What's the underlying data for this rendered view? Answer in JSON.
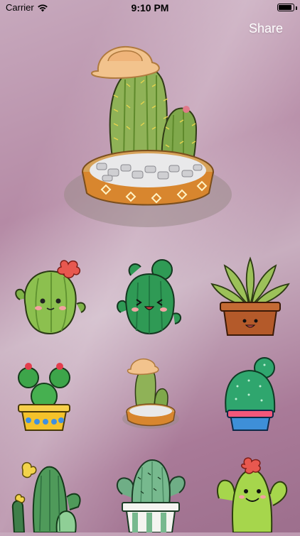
{
  "status_bar": {
    "carrier": "Carrier",
    "time": "9:10 PM",
    "battery_level": 0.9
  },
  "nav": {
    "share_label": "Share"
  },
  "hero": {
    "icon": "potted-cactus-with-hat-icon"
  },
  "stickers": [
    {
      "icon": "cute-round-cactus-with-flower-icon"
    },
    {
      "icon": "smiling-green-cactus-icon"
    },
    {
      "icon": "succulent-in-brown-pot-icon"
    },
    {
      "icon": "cactus-with-red-flowers-yellow-pot-icon"
    },
    {
      "icon": "potted-cactus-with-hat-small-icon"
    },
    {
      "icon": "round-cactus-in-blue-pot-icon"
    },
    {
      "icon": "tall-cactus-group-icon"
    },
    {
      "icon": "cactus-in-striped-pot-icon"
    },
    {
      "icon": "light-green-smiling-cactus-icon"
    }
  ],
  "colors": {
    "background": "#b58aa5",
    "text_light": "#ffffff"
  }
}
